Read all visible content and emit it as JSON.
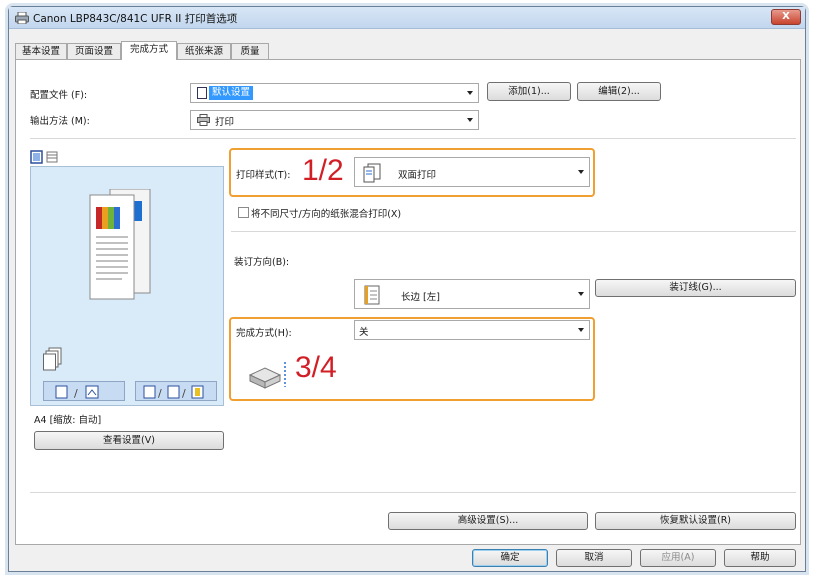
{
  "window": {
    "title": "Canon LBP843C/841C UFR II 打印首选项",
    "close": "X"
  },
  "tabs": [
    {
      "label": "基本设置"
    },
    {
      "label": "页面设置"
    },
    {
      "label": "完成方式",
      "active": true
    },
    {
      "label": "纸张来源"
    },
    {
      "label": "质量"
    }
  ],
  "profile": {
    "label": "配置文件 (F):",
    "value": "默认设置",
    "add_button": "添加(1)...",
    "edit_button": "编辑(2)..."
  },
  "output": {
    "label": "输出方法 (M):",
    "value": "打印"
  },
  "print_style": {
    "label": "打印样式(T):",
    "value": "双面打印",
    "step": "1/2"
  },
  "mixed_paper": {
    "label": "将不同尺寸/方向的纸张混合打印(X)",
    "checked": false
  },
  "binding": {
    "label": "装订方向(B):",
    "value": "长边 [左]",
    "gutter_button": "装订线(G)..."
  },
  "finishing": {
    "label": "完成方式(H):",
    "value": "关",
    "step": "3/4"
  },
  "preview": {
    "status": "A4 [缩放: 自动]",
    "view_settings_button": "查看设置(V)"
  },
  "footer": {
    "advanced_button": "高级设置(S)...",
    "restore_button": "恢复默认设置(R)"
  },
  "dialog_buttons": {
    "ok": "确定",
    "cancel": "取消",
    "apply": "应用(A)",
    "help": "帮助"
  },
  "colors": {
    "highlight": "#f0a030",
    "step_number": "#d21f26",
    "selection": "#3399ff"
  }
}
